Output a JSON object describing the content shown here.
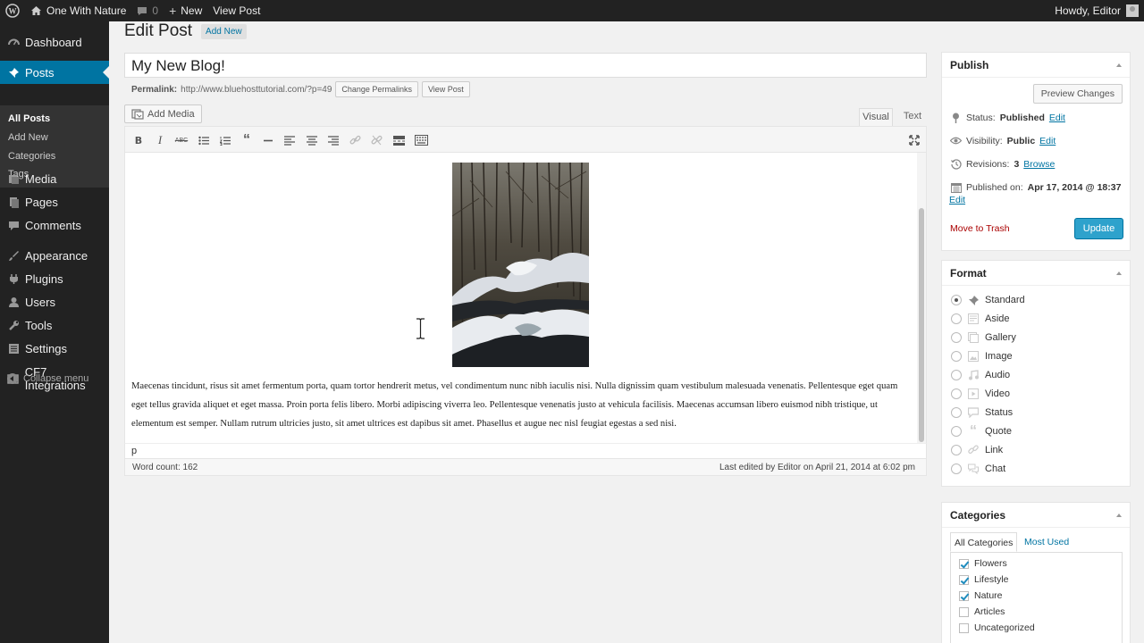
{
  "admin_bar": {
    "site_name": "One With Nature",
    "comments_count": "0",
    "new_label": "New",
    "view_post_label": "View Post",
    "greeting": "Howdy, Editor"
  },
  "menu": {
    "items": [
      {
        "label": "Dashboard",
        "icon": "dashboard-icon"
      },
      {
        "label": "Posts",
        "icon": "pushpin-icon"
      },
      {
        "label": "Media",
        "icon": "media-icon"
      },
      {
        "label": "Pages",
        "icon": "pages-icon"
      },
      {
        "label": "Comments",
        "icon": "comments-icon"
      },
      {
        "label": "Appearance",
        "icon": "paintbrush-icon"
      },
      {
        "label": "Plugins",
        "icon": "plugin-icon"
      },
      {
        "label": "Users",
        "icon": "users-icon"
      },
      {
        "label": "Tools",
        "icon": "wrench-icon"
      },
      {
        "label": "Settings",
        "icon": "settings-icon"
      },
      {
        "label": "CF7 Integrations",
        "icon": "cf7-icon"
      }
    ],
    "submenu": [
      "All Posts",
      "Add New",
      "Categories",
      "Tags"
    ],
    "collapse_label": "Collapse menu"
  },
  "page": {
    "title": "Edit Post",
    "add_new": "Add New"
  },
  "post": {
    "title": "My New Blog!",
    "permalink_label": "Permalink:",
    "permalink_url": "http://www.bluehosttutorial.com/?p=49",
    "change_permalinks": "Change Permalinks",
    "view_post": "View Post",
    "add_media": "Add Media",
    "tab_visual": "Visual",
    "tab_text": "Text",
    "body": "Maecenas tincidunt, risus sit amet fermentum porta, quam tortor hendrerit metus, vel condimentum nunc nibh iaculis nisi. Nulla dignissim quam vestibulum malesuada venenatis. Pellentesque eget quam eget tellus gravida aliquet et eget massa. Proin porta felis libero. Morbi adipiscing viverra leo. Pellentesque venenatis justo at vehicula facilisis. Maecenas accumsan libero euismod nibh tristique, ut elementum est semper. Nullam rutrum ultricies justo, sit amet ultrices est dapibus sit amet. Phasellus et augue nec nisl feugiat egestas a sed nisi.",
    "path": "p",
    "word_count": "Word count: 162",
    "last_edited": "Last edited by Editor on April 21, 2014 at 6:02 pm"
  },
  "toolbar": [
    "bold-icon",
    "italic-icon",
    "strikethrough-icon",
    "bullet-list-icon",
    "numbered-list-icon",
    "blockquote-icon",
    "horizontal-rule-icon",
    "align-left-icon",
    "align-center-icon",
    "align-right-icon",
    "link-icon",
    "unlink-icon",
    "read-more-icon",
    "toolbar-toggle-icon",
    "fullscreen-icon"
  ],
  "publish": {
    "title": "Publish",
    "preview_changes": "Preview Changes",
    "status_label": "Status:",
    "status_value": "Published",
    "visibility_label": "Visibility:",
    "visibility_value": "Public",
    "revisions_label": "Revisions:",
    "revisions_value": "3",
    "browse": "Browse",
    "published_on_label": "Published on:",
    "published_on_value": "Apr 17, 2014 @ 18:37",
    "edit": "Edit",
    "move_to_trash": "Move to Trash",
    "update": "Update"
  },
  "format": {
    "title": "Format",
    "selected": "Standard",
    "options": [
      {
        "label": "Standard",
        "icon": "pushpin-icon"
      },
      {
        "label": "Aside",
        "icon": "aside-icon"
      },
      {
        "label": "Gallery",
        "icon": "gallery-icon"
      },
      {
        "label": "Image",
        "icon": "image-icon"
      },
      {
        "label": "Audio",
        "icon": "audio-icon"
      },
      {
        "label": "Video",
        "icon": "video-icon"
      },
      {
        "label": "Status",
        "icon": "status-icon"
      },
      {
        "label": "Quote",
        "icon": "quote-icon"
      },
      {
        "label": "Link",
        "icon": "link-icon"
      },
      {
        "label": "Chat",
        "icon": "chat-icon"
      }
    ]
  },
  "categories": {
    "title": "Categories",
    "tab_all": "All Categories",
    "tab_most_used": "Most Used",
    "items": [
      {
        "label": "Flowers",
        "checked": true
      },
      {
        "label": "Lifestyle",
        "checked": true
      },
      {
        "label": "Nature",
        "checked": true
      },
      {
        "label": "Articles",
        "checked": false
      },
      {
        "label": "Uncategorized",
        "checked": false
      }
    ]
  },
  "colors": {
    "admin_dark": "#222222",
    "accent_blue": "#0074a2",
    "update_button": "#2ea2cc",
    "trash_red": "#aa0000"
  }
}
